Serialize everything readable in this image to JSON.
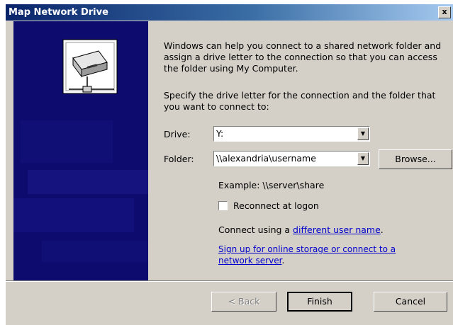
{
  "window": {
    "title": "Map Network Drive",
    "close_symbol": "x"
  },
  "content": {
    "intro_text": "Windows can help you connect to a shared network folder and assign a drive letter to the connection so that you can access the folder using My Computer.",
    "specify_text": "Specify the drive letter for the connection and the folder that you want to connect to:",
    "drive_label": "Drive:",
    "drive_value": "Y:",
    "folder_label": "Folder:",
    "folder_value": "\\\\alexandria\\username",
    "browse_label": "Browse...",
    "example_text": "Example: \\\\server\\share",
    "reconnect_label": "Reconnect at logon",
    "reconnect_checked": false,
    "connect_prefix": "Connect using a ",
    "connect_link": "different user name",
    "connect_suffix": ".",
    "signup_link": "Sign up for online storage or connect to a network server",
    "signup_suffix": "."
  },
  "footer": {
    "back_label": "< Back",
    "finish_label": "Finish",
    "cancel_label": "Cancel"
  },
  "icons": {
    "banner": "network-drive-icon",
    "dropdown": "chevron-down-icon"
  },
  "colors": {
    "title_gradient_start": "#0a246a",
    "banner_bg": "#0d0c6e",
    "dialog_bg": "#d4d0c8",
    "link": "#0000cc"
  }
}
